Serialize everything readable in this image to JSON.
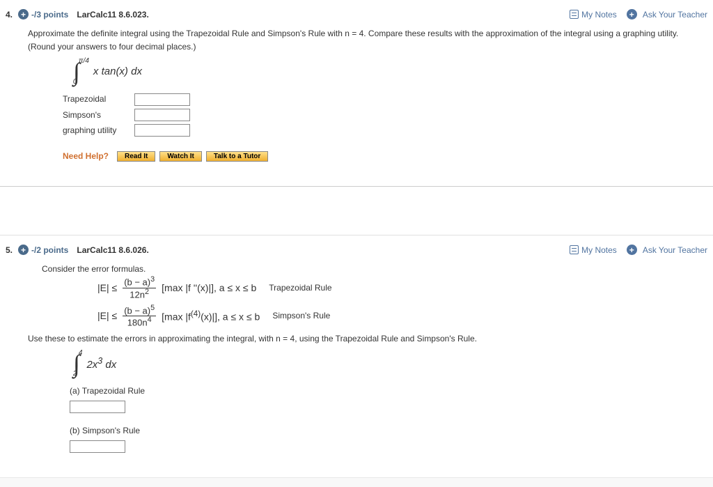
{
  "q4": {
    "number": "4.",
    "points": "-/3 points",
    "ref": "LarCalc11 8.6.023.",
    "myNotes": "My Notes",
    "askTeacher": "Ask Your Teacher",
    "prompt": "Approximate the definite integral using the Trapezoidal Rule and Simpson's Rule with n = 4. Compare these results with the approximation of the integral using a graphing utility. (Round your answers to four decimal places.)",
    "integral": {
      "upper": "π/4",
      "lower": "0",
      "expr": "x tan(x) dx"
    },
    "rows": {
      "trap": "Trapezoidal",
      "simp": "Simpson's",
      "graph": "graphing utility"
    },
    "helpLabel": "Need Help?",
    "helpButtons": {
      "read": "Read It",
      "watch": "Watch It",
      "talk": "Talk to a Tutor"
    }
  },
  "q5": {
    "number": "5.",
    "points": "-/2 points",
    "ref": "LarCalc11 8.6.026.",
    "myNotes": "My Notes",
    "askTeacher": "Ask Your Teacher",
    "prompt1": "Consider the error formulas.",
    "formula1": {
      "lhs": "|E| ≤",
      "numExpr": "(b − a)",
      "numPow": "3",
      "den": "12n",
      "denPow": "2",
      "rest": "[max |f ''(x)|],  a ≤ x ≤ b",
      "label": "Trapezoidal Rule"
    },
    "formula2": {
      "lhs": "|E| ≤",
      "numExpr": "(b − a)",
      "numPow": "5",
      "den": "180n",
      "denPow": "4",
      "rest": "[max |f",
      "restSup": "(4)",
      "rest2": "(x)|],  a ≤ x ≤ b",
      "label": "Simpson's Rule"
    },
    "prompt2": "Use these to estimate the errors in approximating the integral, with n = 4, using the Trapezoidal Rule and Simpson's Rule.",
    "integral": {
      "upper": "4",
      "lower": "2",
      "expr": "2x",
      "pow": "3",
      "suffix": " dx"
    },
    "partA": "(a) Trapezoidal Rule",
    "partB": "(b) Simpson's Rule"
  }
}
